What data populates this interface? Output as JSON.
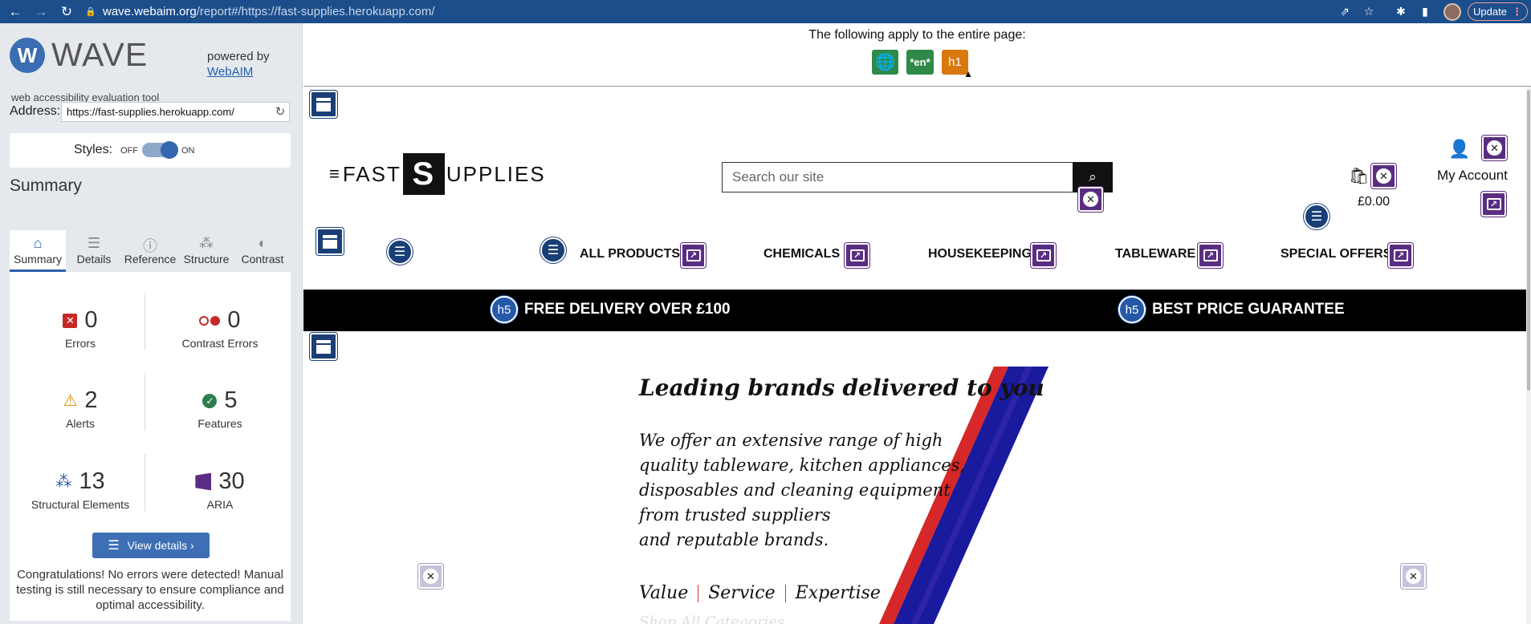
{
  "browser": {
    "url_domain": "wave.webaim.org",
    "url_path": "/report#/https://fast-supplies.herokuapp.com/",
    "update_label": "Update"
  },
  "wave": {
    "logo_text": "WAVE",
    "logo_tagline": "web accessibility evaluation tool",
    "powered_by": "powered by",
    "webaim_link": "WebAIM",
    "address_label": "Address:",
    "address_value": "https://fast-supplies.herokuapp.com/",
    "styles_label": "Styles:",
    "styles_off": "OFF",
    "styles_on": "ON",
    "summary_heading": "Summary",
    "tabs": [
      {
        "label": "Summary",
        "icon": "home-icon",
        "active": true
      },
      {
        "label": "Details",
        "icon": "list-icon",
        "active": false
      },
      {
        "label": "Reference",
        "icon": "info-icon",
        "active": false
      },
      {
        "label": "Structure",
        "icon": "structure-icon",
        "active": false
      },
      {
        "label": "Contrast",
        "icon": "contrast-icon",
        "active": false
      }
    ],
    "stats": [
      {
        "count": "0",
        "label": "Errors",
        "color": "#c62828"
      },
      {
        "count": "0",
        "label": "Contrast Errors",
        "color": "#c62828"
      },
      {
        "count": "2",
        "label": "Alerts",
        "color": "#e08a00"
      },
      {
        "count": "5",
        "label": "Features",
        "color": "#2e7d4f"
      },
      {
        "count": "13",
        "label": "Structural Elements",
        "color": "#2f5ea8"
      },
      {
        "count": "30",
        "label": "ARIA",
        "color": "#5a2d82"
      }
    ],
    "view_details_label": "View details ›",
    "congrats": "Congratulations! No errors were detected! Manual testing is still necessary to ensure compliance and optimal accessibility."
  },
  "report": {
    "page_note": "The following apply to the entire page:",
    "page_icons": [
      "language-icon",
      "*en*",
      "h1"
    ],
    "site": {
      "logo_left": "FAST",
      "logo_s": "S",
      "logo_right": "UPPLIES",
      "search_placeholder": "Search our site",
      "cart_total": "£0.00",
      "account_label": "My Account",
      "menu": [
        "ALL PRODUCTS",
        "CHEMICALS",
        "HOUSEKEEPING",
        "TABLEWARE",
        "SPECIAL OFFERS"
      ],
      "strip": [
        "FREE DELIVERY OVER £100",
        "BEST PRICE GUARANTEE"
      ],
      "hero_title": "Leading brands delivered to you",
      "hero_body": [
        "We offer an extensive range of high",
        "quality tableware, kitchen appliances,",
        "disposables and cleaning equipment",
        "from trusted suppliers",
        "and reputable brands."
      ],
      "hero_tags": [
        "Value",
        "Service",
        "Expertise"
      ],
      "hero_faded": "Shop All Categories"
    },
    "colors": {
      "stripe_red": "#d62828",
      "stripe_blue": "#1a1a9e",
      "aria_purple": "#5a2d82",
      "structure_blue": "#1a3f77"
    }
  }
}
